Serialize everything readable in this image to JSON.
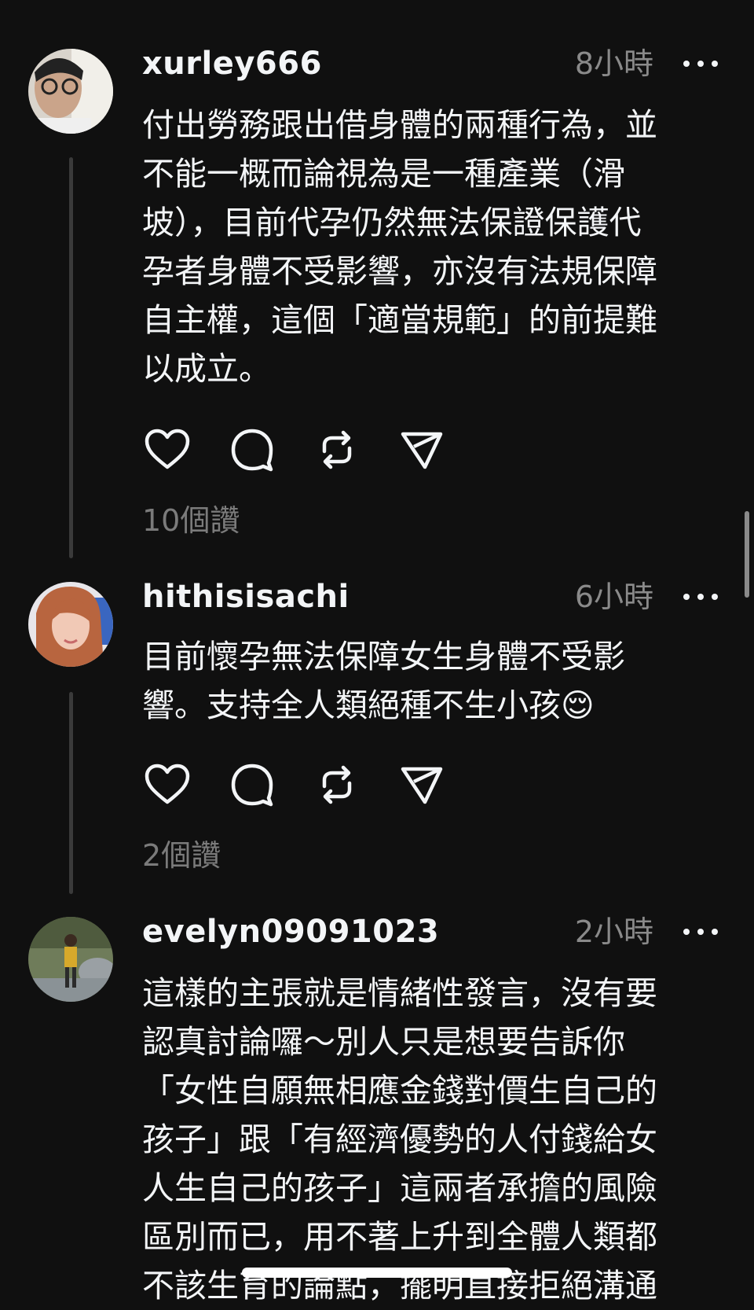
{
  "posts": [
    {
      "username": "xurley666",
      "time": "8小時",
      "body": "付出勞務跟出借身體的兩種行為，並\n不能一概而論視為是一種產業（滑\n坡），目前代孕仍然無法保證保護代\n孕者身體不受影響，亦沒有法規保障\n自主權，這個「適當規範」的前提難\n以成立。",
      "likes": "10個讚"
    },
    {
      "username": "hithisisachi",
      "time": "6小時",
      "body": "目前懷孕無法保障女生身體不受影\n響。支持全人類絕種不生小孩😌",
      "likes": "2個讚"
    },
    {
      "username": "evelyn09091023",
      "time": "2小時",
      "body": "這樣的主張就是情緒性發言，沒有要\n認真討論囉～別人只是想要告訴你\n「女性自願無相應金錢對價生自己的\n孩子」跟「有經濟優勢的人付錢給女\n人生自己的孩子」這兩者承擔的風險\n區別而已，用不著上升到全體人類都\n不該生育的論點，擺明直接拒絕溝通"
    }
  ],
  "icons": {
    "like": "heart-icon",
    "reply": "comment-icon",
    "repost": "repost-icon",
    "share": "send-icon",
    "more": "more-icon"
  }
}
